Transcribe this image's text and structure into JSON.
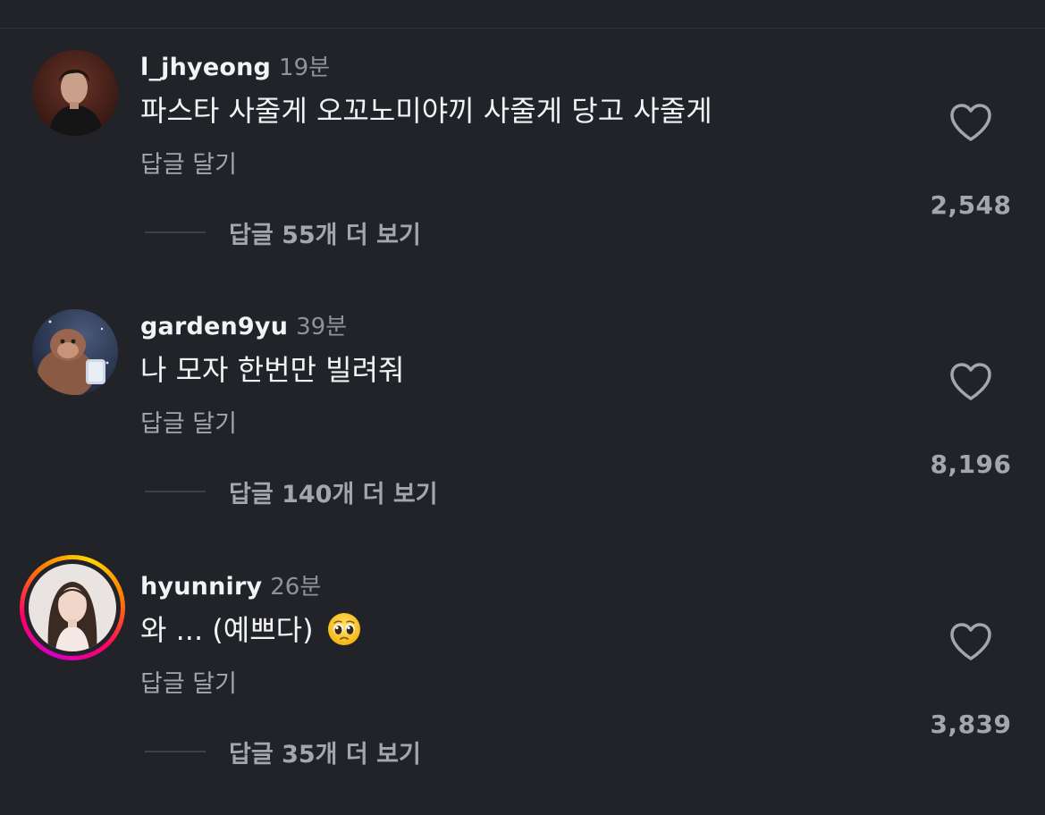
{
  "comments": [
    {
      "username": "l_jhyeong",
      "time": "19분",
      "text": "파스타 사줄게 오꼬노미야끼 사줄게 당고 사줄게",
      "reply_label": "답글 달기",
      "view_replies": "답글 55개 더 보기",
      "likes": "2,548",
      "avatar_icon": "profile-photo"
    },
    {
      "username": "garden9yu",
      "time": "39분",
      "text": "나 모자 한번만 빌려줘",
      "reply_label": "답글 달기",
      "view_replies": "답글 140개 더 보기",
      "likes": "8,196",
      "avatar_icon": "profile-photo"
    },
    {
      "username": "hyunniry",
      "time": "26분",
      "text": "와 ... (예쁘다)",
      "emoji": "pleading-face",
      "reply_label": "답글 달기",
      "view_replies": "답글 35개 더 보기",
      "likes": "3,839",
      "avatar_icon": "profile-photo",
      "story_ring": true
    }
  ],
  "icons": {
    "like": "heart-outline-icon"
  },
  "colors": {
    "background": "#212329",
    "primary_text": "#f2f3f5",
    "secondary_text": "#a3a6ad",
    "time_text": "#8e929b",
    "story_ring": [
      "#d300c5",
      "#ff0069",
      "#ff7a00",
      "#ffd600"
    ]
  }
}
